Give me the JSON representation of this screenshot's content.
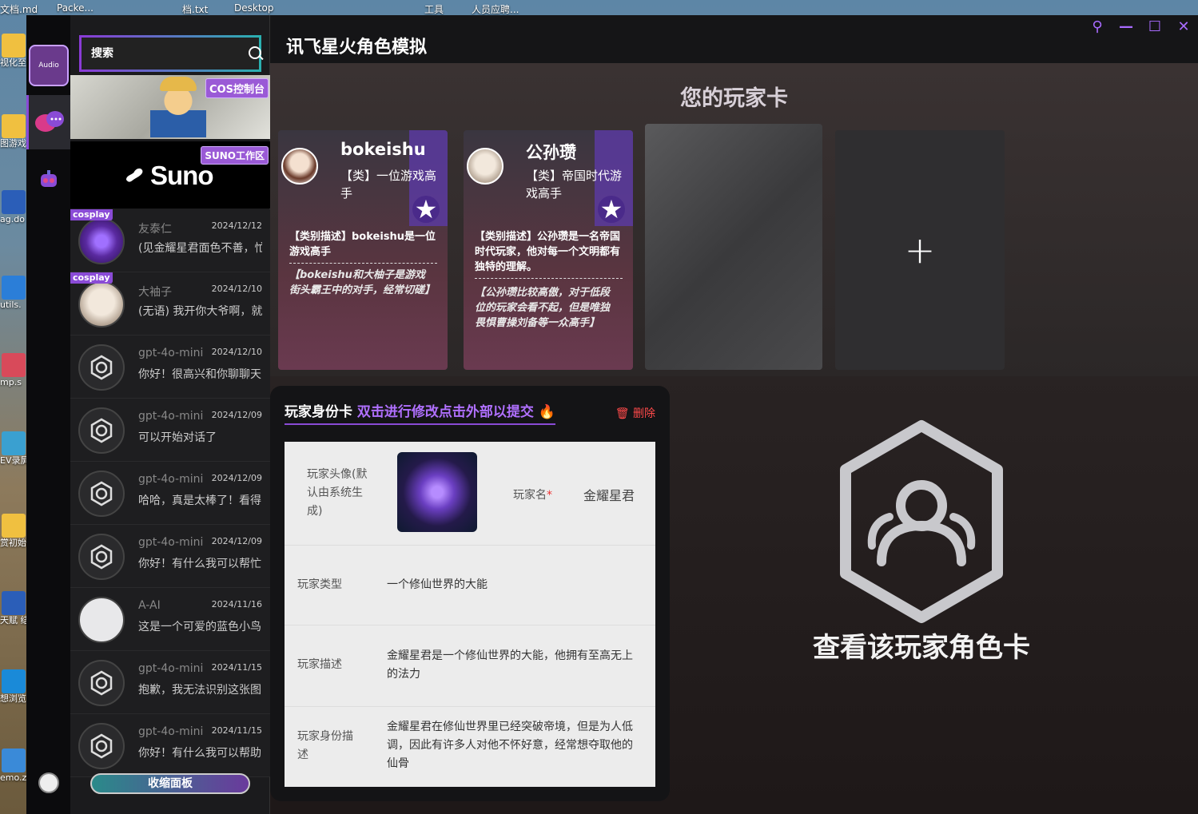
{
  "desktop": {
    "top_labels": [
      "文档.md",
      "Packe...",
      "档.txt",
      "Desktop",
      "工具",
      "人员应聘..."
    ],
    "side_labels": [
      "视化至数据",
      "图游戏成ex",
      "ag.do",
      "utils.",
      "mp.s",
      "EV录屏",
      "赏初始程",
      "天赋 结质测评",
      "想浏览",
      "emo.z"
    ]
  },
  "rail": {
    "audio_label": "Audio"
  },
  "search": {
    "placeholder": "搜索"
  },
  "banners": {
    "cos_tag": "COS控制台",
    "suno_tag": "SUNO工作区",
    "suno_logo": "Suno"
  },
  "conversations": [
    {
      "name": "友泰仁",
      "date": "2024/12/12",
      "preview": "(见金耀星君面色不善，忙",
      "badge": "cosplay",
      "avatar": "magic-circle"
    },
    {
      "name": "大袖子",
      "date": "2024/12/10",
      "preview": "(无语) 我开你大爷啊，就",
      "badge": "cosplay",
      "avatar": "face"
    },
    {
      "name": "gpt-4o-mini",
      "date": "2024/12/10",
      "preview": "你好！很高兴和你聊聊天",
      "badge": "",
      "avatar": "openai"
    },
    {
      "name": "gpt-4o-mini",
      "date": "2024/12/09",
      "preview": "可以开始对话了",
      "badge": "",
      "avatar": "openai"
    },
    {
      "name": "gpt-4o-mini",
      "date": "2024/12/09",
      "preview": "哈哈，真是太棒了！看得",
      "badge": "",
      "avatar": "openai"
    },
    {
      "name": "gpt-4o-mini",
      "date": "2024/12/09",
      "preview": "你好！有什么我可以帮忙",
      "badge": "",
      "avatar": "openai"
    },
    {
      "name": "A-AI",
      "date": "2024/11/16",
      "preview": "这是一个可爱的蓝色小鸟",
      "badge": "",
      "avatar": "sketch"
    },
    {
      "name": "gpt-4o-mini",
      "date": "2024/11/15",
      "preview": "抱歉，我无法识别这张图",
      "badge": "",
      "avatar": "openai"
    },
    {
      "name": "gpt-4o-mini",
      "date": "2024/11/15",
      "preview": "你好！有什么我可以帮助",
      "badge": "",
      "avatar": "openai"
    }
  ],
  "collapse_label": "收缩面板",
  "main": {
    "title": "讯飞星火角色模拟",
    "cards_heading": "您的玩家卡",
    "window_controls": [
      "pin-icon",
      "minimize-icon",
      "maximize-icon",
      "close-icon"
    ]
  },
  "player_cards": [
    {
      "name": "bokeishu",
      "type": "【类】一位游戏高手",
      "desc": "【类别描述】bokeishu是一位游戏高手",
      "detail": "【bokeishu和大柚子是游戏街头霸王中的对手，经常切磋】"
    },
    {
      "name": "公孙瓒",
      "type": "【类】帝国时代游戏高手",
      "desc": "【类别描述】公孙瓒是一名帝国时代玩家，他对每一个文明都有独特的理解。",
      "detail": "【公孙瓒比较高傲，对于低段位的玩家会看不起，但是唯独畏惧曹操刘备等一众高手】"
    }
  ],
  "add_card_symbol": "+",
  "identity": {
    "header": "玩家身份卡",
    "hint": "双击进行修改点击外部以提交",
    "delete_label": "删除",
    "avatar_label": "玩家头像(默认由系统生成)",
    "name_label": "玩家名",
    "name_value": "金耀星君",
    "type_label": "玩家类型",
    "type_value": "一个修仙世界的大能",
    "desc_label": "玩家描述",
    "desc_value": "金耀星君是一个修仙世界的大能，他拥有至高无上的法力",
    "identity_label": "玩家身份描述",
    "identity_value": "金耀星君在修仙世界里已经突破帝境，但是为人低调，因此有许多人对他不怀好意，经常想夺取他的仙骨"
  },
  "view_card_label": "查看该玩家角色卡",
  "colors": {
    "accent": "#8a4bd6",
    "accent_light": "#b070ff",
    "danger": "#ff4a4a",
    "teal": "#2ab0b0"
  }
}
